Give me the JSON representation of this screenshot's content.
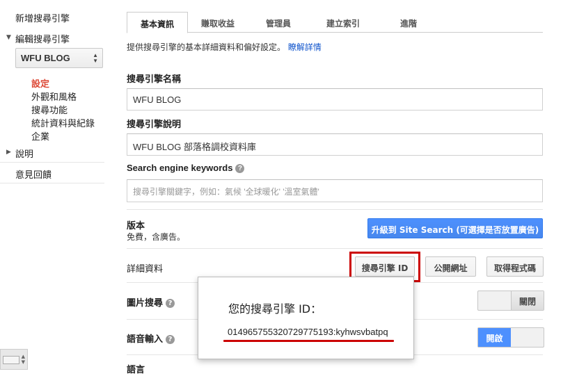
{
  "sidebar": {
    "new_engine": "新增搜尋引擎",
    "edit_engine": "編輯搜尋引擎",
    "selected_engine": "WFU BLOG",
    "sub_items": [
      "設定",
      "外觀和風格",
      "搜尋功能",
      "統計資料與紀錄",
      "企業"
    ],
    "help": "說明",
    "feedback": "意見回饋"
  },
  "tabs": [
    "基本資訊",
    "賺取收益",
    "管理員",
    "建立索引",
    "進階"
  ],
  "description": {
    "text": "提供搜尋引擎的基本詳細資料和偏好設定。",
    "link": "瞭解詳情"
  },
  "fields": {
    "name_label": "搜尋引擎名稱",
    "name_value": "WFU BLOG",
    "desc_label": "搜尋引擎說明",
    "desc_value": "WFU BLOG 部落格調校資料庫",
    "keywords_label": "Search engine keywords",
    "keywords_placeholder": "搜尋引擎關鍵字，例如：氣候 '全球暖化' '溫室氣體'"
  },
  "edition": {
    "label": "版本",
    "value": "免費，含廣告。",
    "upgrade_button": "升級到 Site Search (可選擇是否放置廣告)"
  },
  "details": {
    "label": "詳細資料",
    "engine_id_button": "搜尋引擎 ID",
    "public_url_button": "公開網址",
    "get_code_button": "取得程式碼"
  },
  "image_search": {
    "label": "圖片搜尋",
    "toggle_state": "關閉"
  },
  "voice_input": {
    "label": "語音輸入",
    "toggle_state": "開啟"
  },
  "language": {
    "label": "語言"
  },
  "popup": {
    "title": "您的搜尋引擎 ID：",
    "engine_id": "014965755320729775193:kyhwsvbatpq"
  },
  "colors": {
    "accent_blue": "#4d90fe",
    "active_red": "#dd4b39",
    "highlight_red": "#cc0000"
  }
}
